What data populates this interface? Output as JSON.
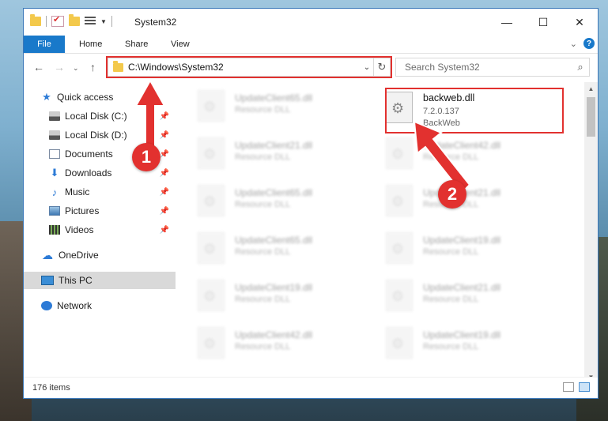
{
  "window": {
    "title": "System32"
  },
  "ribbon": {
    "tabs": [
      "File",
      "Home",
      "Share",
      "View"
    ],
    "help_label": "?"
  },
  "address": {
    "path": "C:\\Windows\\System32"
  },
  "search": {
    "placeholder": "Search System32"
  },
  "nav": {
    "quick_access": "Quick access",
    "items": [
      {
        "label": "Local Disk (C:)"
      },
      {
        "label": "Local Disk (D:)"
      },
      {
        "label": "Documents"
      },
      {
        "label": "Downloads"
      },
      {
        "label": "Music"
      },
      {
        "label": "Pictures"
      },
      {
        "label": "Videos"
      }
    ],
    "onedrive": "OneDrive",
    "this_pc": "This PC",
    "network": "Network"
  },
  "files": {
    "left": [
      {
        "name": "UpdateClient65.dll",
        "desc": "Resource DLL"
      },
      {
        "name": "UpdateClient21.dll",
        "desc": "Resource DLL"
      },
      {
        "name": "UpdateClient65.dll",
        "desc": "Resource DLL"
      },
      {
        "name": "UpdateClient65.dll",
        "desc": "Resource DLL"
      },
      {
        "name": "UpdateClient19.dll",
        "desc": "Resource DLL"
      },
      {
        "name": "UpdateClient42.dll",
        "desc": "Resource DLL"
      }
    ],
    "right": [
      {
        "name": "UpdateClient42.dll",
        "desc": "Resource DLL"
      },
      {
        "name": "UpdateClient21.dll",
        "desc": "Resource DLL"
      },
      {
        "name": "UpdateClient19.dll",
        "desc": "Resource DLL"
      },
      {
        "name": "UpdateClient21.dll",
        "desc": "Resource DLL"
      },
      {
        "name": "UpdateClient19.dll",
        "desc": "Resource DLL"
      }
    ],
    "focus": {
      "name": "backweb.dll",
      "version": "7.2.0.137",
      "company": "BackWeb"
    }
  },
  "status": {
    "item_count": "176 items"
  },
  "annotations": {
    "step1": "1",
    "step2": "2",
    "color": "#e2312f"
  }
}
